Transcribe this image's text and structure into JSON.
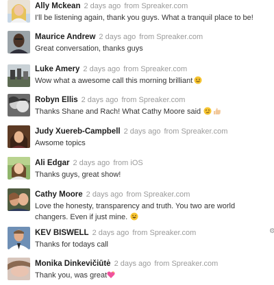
{
  "comments": [
    {
      "author": "Ally Mckean",
      "time": "2 days ago",
      "source": "from Spreaker.com",
      "text": "I'll be listening again, thank you guys. What a tranquil place to be!",
      "avatar": "avatar-ally-mckean"
    },
    {
      "author": "Maurice Andrew",
      "time": "2 days ago",
      "source": "from Spreaker.com",
      "text": "Great conversation, thanks guys",
      "avatar": "avatar-maurice-andrew"
    },
    {
      "author": "Luke Amery",
      "time": "2 days ago",
      "source": "from Spreaker.com",
      "text": "Wow what a awesome call this morning brilliant",
      "emoji": "smiley-face-emoji",
      "avatar": "avatar-luke-amery"
    },
    {
      "author": "Robyn Ellis",
      "time": "2 days ago",
      "source": "from Spreaker.com",
      "text": "Thanks Shane and Rach! What Cathy Moore said",
      "emoji": "smirk-face-and-thumbs-up-emoji",
      "avatar": "avatar-robyn-ellis"
    },
    {
      "author": "Judy Xuereb-Campbell",
      "time": "2 days ago",
      "source": "from Spreaker.com",
      "text": "Awsome topics",
      "avatar": "avatar-judy-xuereb-campbell"
    },
    {
      "author": "Ali Edgar",
      "time": "2 days ago",
      "source": "from iOS",
      "text": "Thanks guys, great show!",
      "avatar": "avatar-ali-edgar"
    },
    {
      "author": "Cathy Moore",
      "time": "2 days ago",
      "source": "from Spreaker.com",
      "text": "Love the honesty, transparency and truth. You two are world changers. Even if just mine.",
      "emoji": "grinning-face-emoji",
      "avatar": "avatar-cathy-moore"
    },
    {
      "author": "KEV BISWELL",
      "time": "2 days ago",
      "source": "from Spreaker.com",
      "text": "Thanks for todays call",
      "avatar": "avatar-kev-biswell"
    },
    {
      "author": "Monika Dinkevičiūtė",
      "time": "2 days ago",
      "source": "from Spreaker.com",
      "text": "Thank you, was great",
      "emoji": "sparkling-heart-emoji",
      "avatar": "avatar-monika-dinkeviciute"
    }
  ],
  "side_icon": "gear-icon",
  "colors": {
    "author": "#1c1c1c",
    "meta": "#9a9a9a",
    "text": "#333333",
    "background": "#ffffff"
  }
}
